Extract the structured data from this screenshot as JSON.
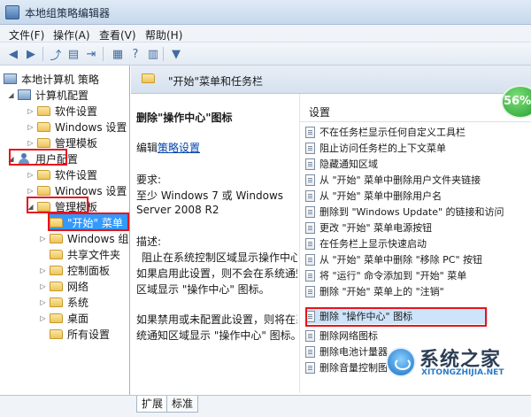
{
  "window": {
    "title": "本地组策略编辑器"
  },
  "menu": [
    "文件(F)",
    "操作(A)",
    "查看(V)",
    "帮助(H)"
  ],
  "toolbar": {
    "icons": [
      "back-arrow-icon",
      "forward-arrow-icon",
      "up-folder-icon",
      "show-tree-icon",
      "export-list-icon",
      "properties-icon",
      "help-icon",
      "filter-icon"
    ]
  },
  "tree": {
    "items": [
      {
        "label": "本地计算机 策略",
        "icon": "computer-policy-icon"
      },
      {
        "label": "计算机配置",
        "icon": "computer-icon"
      },
      {
        "label": "软件设置",
        "icon": "folder-icon"
      },
      {
        "label": "Windows 设置",
        "icon": "folder-icon"
      },
      {
        "label": "管理模板",
        "icon": "folder-icon"
      },
      {
        "label": "用户配置",
        "icon": "user-icon"
      },
      {
        "label": "软件设置",
        "icon": "folder-icon"
      },
      {
        "label": "Windows 设置",
        "icon": "folder-icon"
      },
      {
        "label": "管理模板",
        "icon": "folder-icon"
      },
      {
        "label": "\"开始\" 菜单",
        "icon": "folder-icon"
      },
      {
        "label": "Windows 组件",
        "icon": "folder-icon"
      },
      {
        "label": "共享文件夹",
        "icon": "folder-icon"
      },
      {
        "label": "控制面板",
        "icon": "folder-icon"
      },
      {
        "label": "网络",
        "icon": "folder-icon"
      },
      {
        "label": "系统",
        "icon": "folder-icon"
      },
      {
        "label": "桌面",
        "icon": "folder-icon"
      },
      {
        "label": "所有设置",
        "icon": "folder-icon"
      }
    ]
  },
  "header": {
    "title": "\"开始\"菜单和任务栏"
  },
  "description": {
    "policy_title": "删除\"操作中心\"图标",
    "edit_prefix": "编辑",
    "edit_link": "策略设置",
    "requirements_label": "要求:",
    "requirements_line1": "至少 Windows 7 或 Windows",
    "requirements_line2": "Server 2008 R2",
    "desc_label": "描述:",
    "desc_line1": "阻止在系统控制区域显示操作中心。",
    "desc_line2": "如果启用此设置，则不会在系统通知",
    "desc_line3": "区域显示 \"操作中心\" 图标。",
    "desc_line4": "如果禁用或未配置此设置，则将在系",
    "desc_line5": "统通知区域显示 \"操作中心\" 图标。"
  },
  "settings": {
    "column_header": "设置",
    "rows": [
      "不在任务栏显示任何自定义工具栏",
      "阻止访问任务栏的上下文菜单",
      "隐藏通知区域",
      "从 \"开始\" 菜单中删除用户文件夹链接",
      "从 \"开始\" 菜单中删除用户名",
      "删除到 \"Windows Update\" 的链接和访问",
      "更改 \"开始\" 菜单电源按钮",
      "在任务栏上显示快速启动",
      "从 \"开始\" 菜单中删除 \"移除 PC\" 按钮",
      "将 \"运行\" 命令添加到 \"开始\" 菜单",
      "删除 \"开始\" 菜单上的 \"注销\"",
      "删除 \"操作中心\" 图标",
      "删除网络图标",
      "删除电池计量器",
      "删除音量控制图标"
    ]
  },
  "badge": {
    "percent": "56%",
    "color": "#2ba33a"
  },
  "tabs": [
    "扩展",
    "标准"
  ],
  "watermark": {
    "text": "系统之家",
    "url": "XITONGZHIJIA.NET"
  },
  "colors": {
    "annotation": "#e8141b",
    "highlight": "#cde5fb",
    "selection": "#3399ff"
  }
}
